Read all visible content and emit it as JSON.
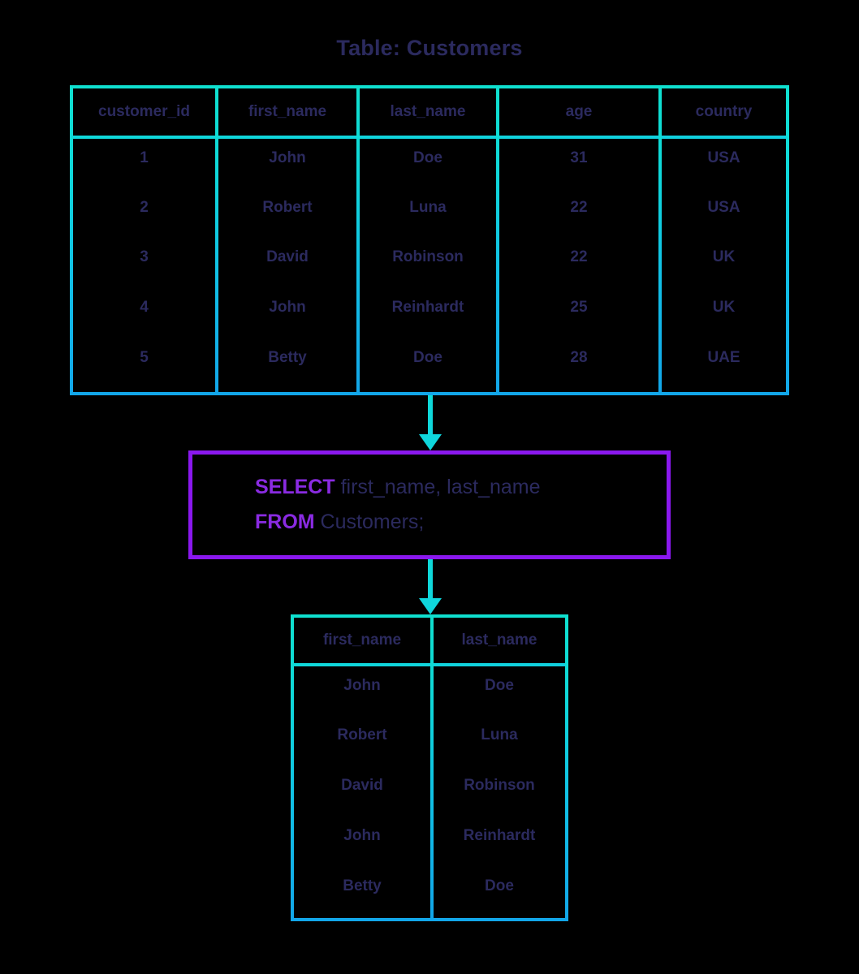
{
  "title": "Table: Customers",
  "source_table": {
    "name": "Customers",
    "columns": [
      "customer_id",
      "first_name",
      "last_name",
      "age",
      "country"
    ],
    "rows": [
      [
        "1",
        "John",
        "Doe",
        "31",
        "USA"
      ],
      [
        "2",
        "Robert",
        "Luna",
        "22",
        "USA"
      ],
      [
        "3",
        "David",
        "Robinson",
        "22",
        "UK"
      ],
      [
        "4",
        "John",
        "Reinhardt",
        "25",
        "UK"
      ],
      [
        "5",
        "Betty",
        "Doe",
        "28",
        "UAE"
      ]
    ]
  },
  "query": {
    "line1_keyword": "SELECT",
    "line1_rest": " first_name, last_name",
    "line2_keyword": "FROM",
    "line2_rest": " Customers;",
    "full_text": "SELECT first_name, last_name FROM Customers;"
  },
  "result_table": {
    "columns": [
      "first_name",
      "last_name"
    ],
    "rows": [
      [
        "John",
        "Doe"
      ],
      [
        "Robert",
        "Luna"
      ],
      [
        "David",
        "Robinson"
      ],
      [
        "John",
        "Reinhardt"
      ],
      [
        "Betty",
        "Doe"
      ]
    ]
  },
  "colors": {
    "background": "#000000",
    "table_border_top": "#0fe0cf",
    "table_border_bottom": "#12a6e9",
    "text": "#2b2a5e",
    "query_box_border": "#8a18ee",
    "keyword": "#8a2be2",
    "arrow": "#0fd6dc"
  }
}
